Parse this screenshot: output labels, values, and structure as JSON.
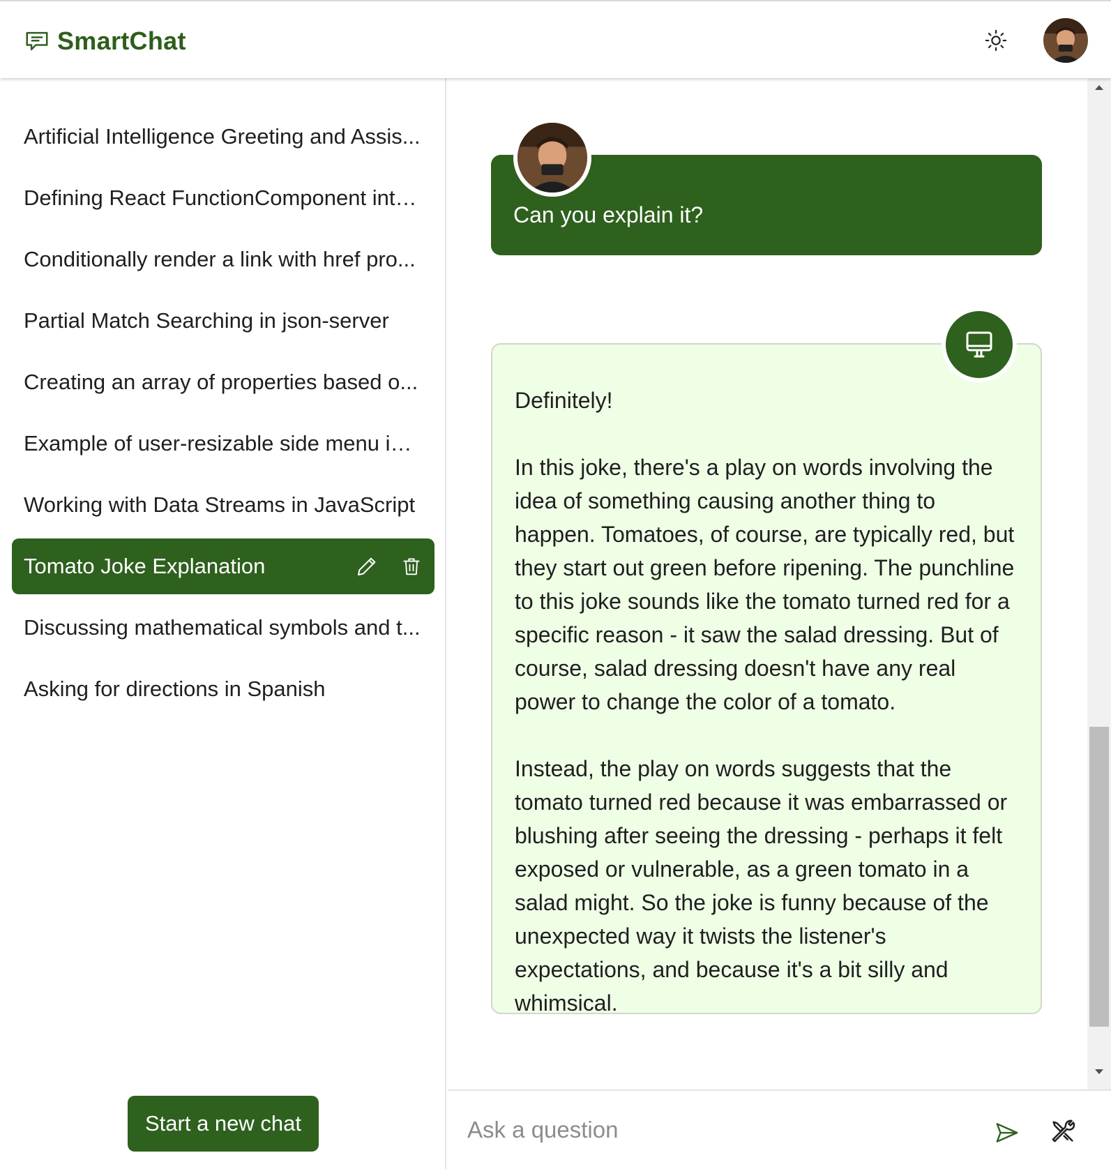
{
  "app": {
    "name": "SmartChat",
    "logo_icon": "chat-bubble-icon",
    "theme_icon": "sun-icon",
    "accent_color": "#2e601e",
    "bot_bubble_color": "#efffe6"
  },
  "sidebar": {
    "chats": [
      {
        "label": "Artificial Intelligence Greeting and Assis..."
      },
      {
        "label": "Defining React FunctionComponent inte..."
      },
      {
        "label": "Conditionally render a link with href pro..."
      },
      {
        "label": "Partial Match Searching in json-server"
      },
      {
        "label": "Creating an array of properties based o..."
      },
      {
        "label": "Example of user-resizable side menu im..."
      },
      {
        "label": "Working with Data Streams in JavaScript"
      },
      {
        "label": "Tomato Joke Explanation",
        "active": true
      },
      {
        "label": "Discussing mathematical symbols and t..."
      },
      {
        "label": "Asking for directions in Spanish"
      }
    ],
    "new_chat_label": "Start a new chat"
  },
  "conversation": {
    "user_message": "Can you explain it?",
    "bot_message": {
      "paragraphs": [
        "Definitely!",
        "In this joke, there's a play on words involving the idea of something causing another thing to happen. Tomatoes, of course, are typically red, but they start out green before ripening. The punchline to this joke sounds like the tomato turned red for a specific reason - it saw the salad dressing. But of course, salad dressing doesn't have any real power to change the color of a tomato.",
        "Instead, the play on words suggests that the tomato turned red because it was embarrassed or blushing after seeing the dressing - perhaps it felt exposed or vulnerable, as a green tomato in a salad might. So the joke is funny because of the unexpected way it twists the listener's expectations, and because it's a bit silly and whimsical."
      ]
    }
  },
  "composer": {
    "placeholder": "Ask a question",
    "send_icon": "send-icon",
    "tools_icon": "tools-icon"
  }
}
